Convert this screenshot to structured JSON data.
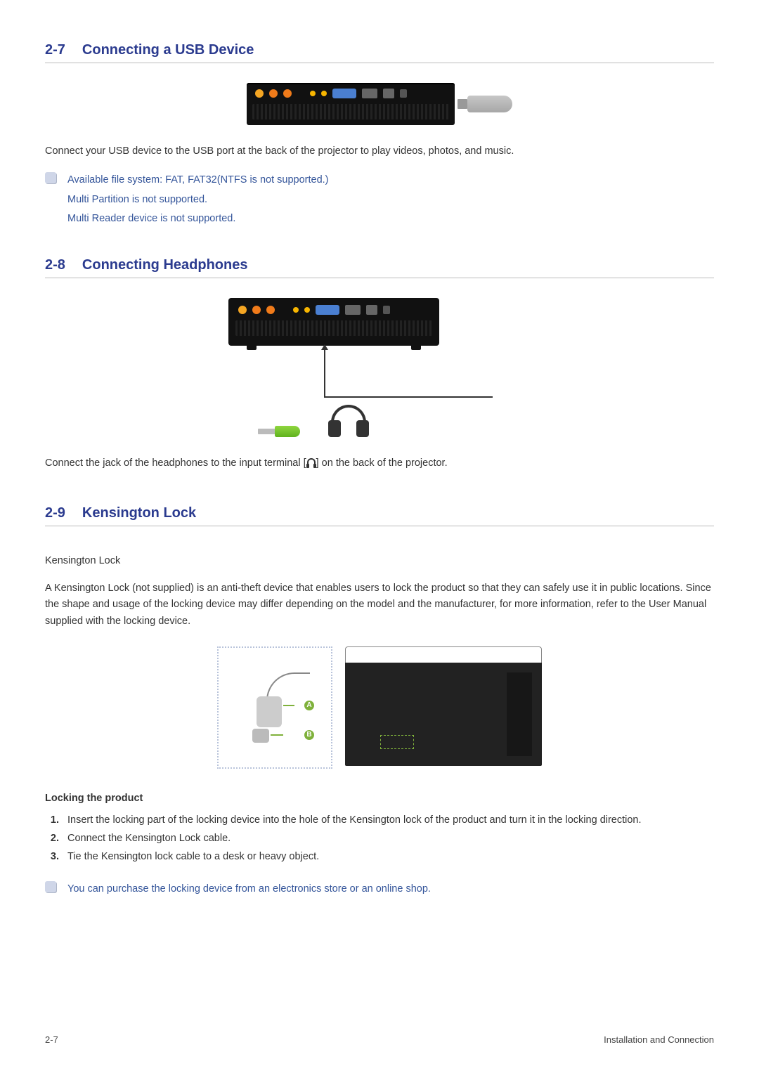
{
  "sections": {
    "s27": {
      "num": "2-7",
      "title": "Connecting a USB Device"
    },
    "s28": {
      "num": "2-8",
      "title": "Connecting Headphones"
    },
    "s29": {
      "num": "2-9",
      "title": "Kensington Lock"
    }
  },
  "usb": {
    "body": "Connect your USB device to the USB port at the back of the projector to play videos, photos, and music.",
    "note_line1": "Available file system: FAT, FAT32(NTFS is not supported.)",
    "note_line2": "Multi Partition is not supported.",
    "note_line3": "Multi Reader device is not supported."
  },
  "headphones": {
    "body_prefix": "Connect the jack of the headphones to the input terminal [",
    "body_suffix": "] on the back of the projector."
  },
  "kensington": {
    "subtitle": "Kensington Lock",
    "body": "A Kensington Lock (not supplied) is an anti-theft device that enables users to lock the product so that they can safely use it in public locations. Since the shape and usage of the locking device may differ depending on the model and the manufacturer, for more information, refer to the User Manual supplied with the locking device.",
    "label_a": "A",
    "label_b": "B",
    "locking_heading": "Locking the product",
    "step1": "Insert the locking part of the locking device into the hole of the Kensington lock of the product and turn it in the locking direction.",
    "step2": "Connect the Kensington Lock cable.",
    "step3": "Tie the Kensington lock cable to a desk or heavy object.",
    "note": "You can purchase the locking device from an electronics store or an online shop."
  },
  "footer": {
    "left": "2-7",
    "right": "Installation and Connection"
  }
}
